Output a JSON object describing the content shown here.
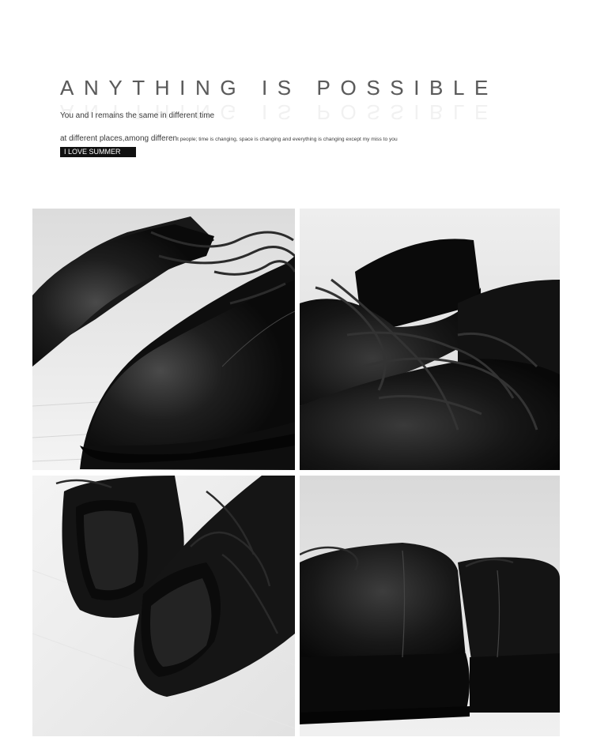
{
  "header": {
    "headline": "ANYTHING IS POSSIBLE",
    "line1": "You and I remains the same in different time",
    "line2_large": "at different places,among differen",
    "line2_small": "t people; time is changing, space is changing and everything is changing except my miss to you",
    "tag": "I LOVE SUMMER"
  },
  "photos": [
    {
      "subject": "black leather lace-up shoe toe close-up"
    },
    {
      "subject": "pair of black leather lace-up shoes with laces"
    },
    {
      "subject": "pair of black leather shoes top view"
    },
    {
      "subject": "black leather shoe heel close-up"
    }
  ],
  "colors": {
    "leather": "#121212",
    "background_photo": "#e9e9e9",
    "text": "#3a3a3a"
  }
}
